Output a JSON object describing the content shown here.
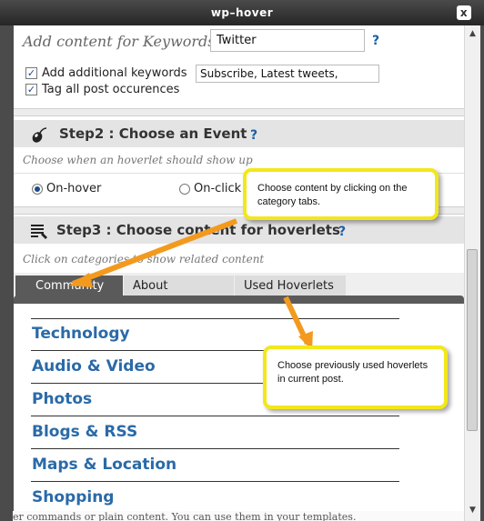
{
  "window": {
    "title": "wp–hover",
    "close": "x"
  },
  "background_text": "er commands or plain content. You can use them in your templates.",
  "keywords": {
    "label": "Add content for Keywords :",
    "value": "Twitter",
    "help": "?",
    "add_additional": {
      "label": "Add additional keywords",
      "checked": true,
      "value": "Subscribe, Latest tweets,"
    },
    "tag_all": {
      "label": "Tag all post occurences",
      "checked": true
    }
  },
  "step2": {
    "icon": "mouse-icon",
    "title": "Step2 : Choose an Event",
    "help": "?",
    "subtitle": "Choose when an hoverlet should show up",
    "options": [
      {
        "label": "On-hover",
        "selected": true
      },
      {
        "label": "On-click",
        "selected": false
      }
    ]
  },
  "step3": {
    "icon": "list-icon",
    "title": "Step3 : Choose content for hoverlets",
    "help": "?",
    "subtitle": "Click on categories to show related content",
    "tabs": [
      {
        "label": "Community",
        "active": true
      },
      {
        "label": "About",
        "active": false
      },
      {
        "label": "Used Hoverlets",
        "active": false
      }
    ],
    "categories": [
      "Technology",
      "Audio & Video",
      "Photos",
      "Blogs & RSS",
      "Maps & Location",
      "Shopping"
    ]
  },
  "callouts": {
    "tabs_tip": "Choose content by clicking on the category tabs.",
    "used_tip": "Choose previously used hoverlets in current post."
  },
  "colors": {
    "link_blue": "#2a6aa8",
    "callout_border": "#f3e71b",
    "arrow_orange": "#f39a1e",
    "tab_active": "#5a5a5a"
  }
}
